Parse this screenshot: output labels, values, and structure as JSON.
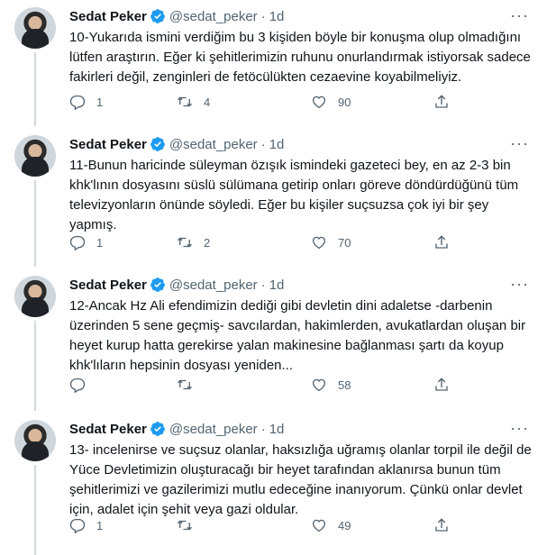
{
  "author": {
    "name": "Sedat Peker",
    "handle": "@sedat_peker",
    "time": "1d",
    "dot": "·"
  },
  "colors": {
    "text": "#0f1419",
    "secondary": "#536471",
    "verified": "#1d9bf0",
    "thread_line": "#cfd9de"
  },
  "tweets": [
    {
      "text": "10-Yukarıda ismini verdiğim bu 3 kişiden böyle bir konuşma olup olmadığını lütfen araştırın. Eğer ki şehitlerimizin ruhunu onurlandırmak istiyorsak sadece fakirleri değil, zenginleri de fetöcülükten cezaevine koyabilmeliyiz.",
      "replies": "1",
      "retweets": "4",
      "likes": "90"
    },
    {
      "text": "11-Bunun haricinde süleyman özışık ismindeki gazeteci bey, en az 2-3 bin khk'lının dosyasını süslü sülümana getirip onları göreve döndürdüğünü tüm televizyonların önünde söyledi. Eğer bu kişiler suçsuzsa çok iyi bir şey yapmış.",
      "replies": "1",
      "retweets": "2",
      "likes": "70"
    },
    {
      "text": "12-Ancak Hz Ali efendimizin dediği gibi devletin dini adaletse -darbenin üzerinden 5 sene geçmiş- savcılardan, hakimlerden, avukatlardan oluşan bir heyet kurup hatta gerekirse yalan makinesine bağlanması şartı da koyup khk'lıların hepsinin dosyası yeniden...",
      "replies": "",
      "retweets": "",
      "likes": "58"
    },
    {
      "text": "13- incelenirse ve suçsuz olanlar, haksızlığa uğramış olanlar torpil ile değil de Yüce Devletimizin oluşturacağı bir heyet tarafından aklanırsa bunun tüm şehitlerimizi ve gazilerimizi mutlu edeceğine inanıyorum. Çünkü onlar devlet için, adalet için şehit veya gazi oldular.",
      "replies": "1",
      "retweets": "",
      "likes": "49"
    }
  ]
}
